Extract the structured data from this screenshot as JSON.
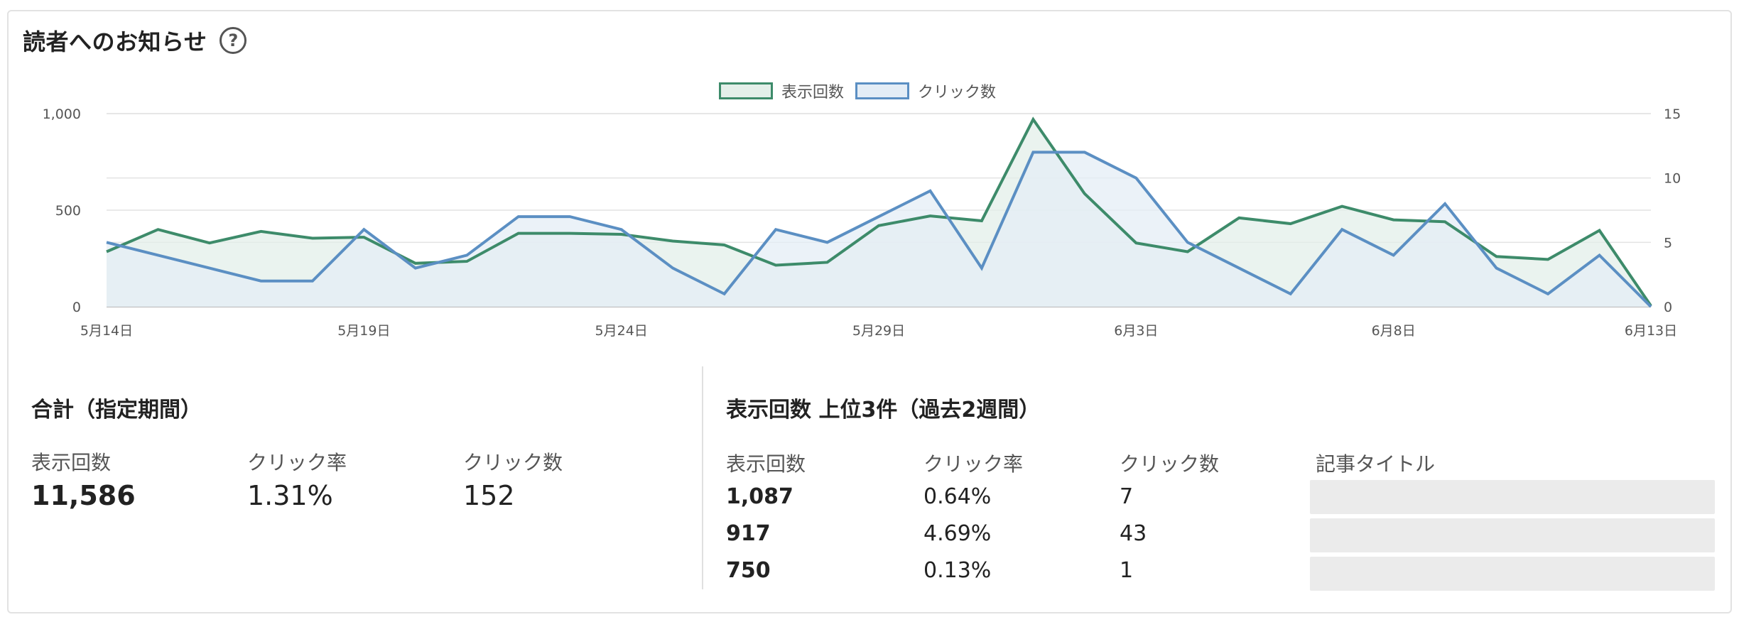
{
  "header": {
    "title": "読者へのお知らせ",
    "help_icon": "?"
  },
  "legend": {
    "impressions_label": "表示回数",
    "clicks_label": "クリック数"
  },
  "colors": {
    "impressions": "#3d8b6a",
    "impressions_fill": "#e3efe9",
    "clicks": "#5b8fc3",
    "clicks_fill": "#e4edf6",
    "grid": "#e3e3e3",
    "axis": "#bbbbbb"
  },
  "chart_data": {
    "type": "line",
    "x": [
      "5月14日",
      "5月15日",
      "5月16日",
      "5月17日",
      "5月18日",
      "5月19日",
      "5月20日",
      "5月21日",
      "5月22日",
      "5月23日",
      "5月24日",
      "5月25日",
      "5月26日",
      "5月27日",
      "5月28日",
      "5月29日",
      "5月30日",
      "5月31日",
      "6月1日",
      "6月2日",
      "6月3日",
      "6月4日",
      "6月5日",
      "6月6日",
      "6月7日",
      "6月8日",
      "6月9日",
      "6月10日",
      "6月11日",
      "6月12日",
      "6月13日"
    ],
    "x_tick_labels": [
      "5月14日",
      "5月19日",
      "5月24日",
      "5月29日",
      "6月3日",
      "6月8日",
      "6月13日"
    ],
    "series": [
      {
        "name": "表示回数",
        "axis": "left",
        "values": [
          285,
          400,
          330,
          390,
          355,
          360,
          225,
          235,
          380,
          380,
          375,
          340,
          320,
          215,
          230,
          420,
          470,
          445,
          970,
          585,
          330,
          285,
          460,
          430,
          520,
          450,
          440,
          260,
          245,
          395,
          5
        ]
      },
      {
        "name": "クリック数",
        "axis": "right",
        "values": [
          5,
          4,
          3,
          2,
          2,
          6,
          3,
          4,
          7,
          7,
          6,
          3,
          1,
          6,
          5,
          7,
          9,
          3,
          12,
          12,
          10,
          5,
          3,
          1,
          6,
          4,
          8,
          3,
          1,
          4,
          0
        ]
      }
    ],
    "y_left": {
      "ticks": [
        "0",
        "500",
        "1,000"
      ],
      "lim": [
        0,
        1000
      ]
    },
    "y_right": {
      "ticks": [
        "0",
        "5",
        "10",
        "15"
      ],
      "lim": [
        0,
        15
      ]
    },
    "legend_position": "top-center",
    "grid": true
  },
  "totals": {
    "title": "合計（指定期間）",
    "impressions_label": "表示回数",
    "impressions_value": "11,586",
    "ctr_label": "クリック率",
    "ctr_value": "1.31%",
    "clicks_label": "クリック数",
    "clicks_value": "152"
  },
  "top3": {
    "title": "表示回数 上位3件（過去2週間）",
    "headers": {
      "impressions": "表示回数",
      "ctr": "クリック率",
      "clicks": "クリック数",
      "article_title": "記事タイトル"
    },
    "rows": [
      {
        "impressions": "1,087",
        "ctr": "0.64%",
        "clicks": "7"
      },
      {
        "impressions": "917",
        "ctr": "4.69%",
        "clicks": "43"
      },
      {
        "impressions": "750",
        "ctr": "0.13%",
        "clicks": "1"
      }
    ]
  }
}
